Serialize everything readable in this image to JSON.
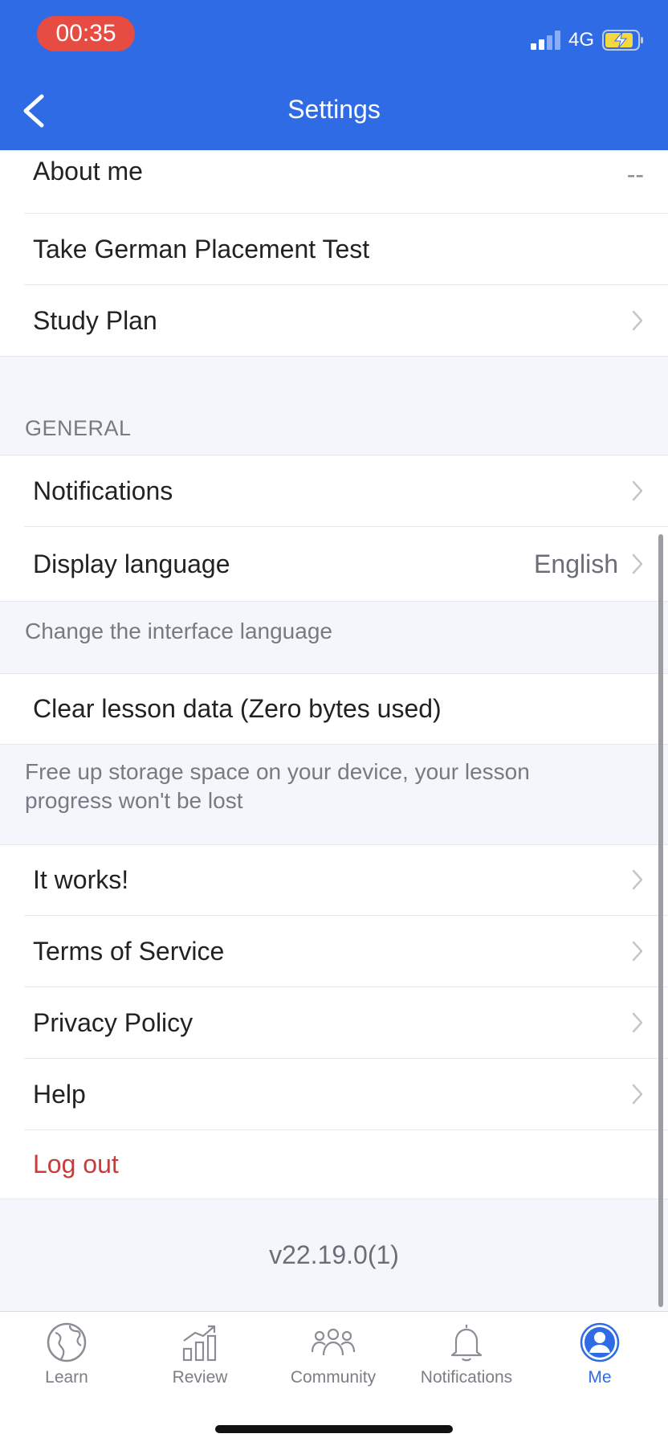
{
  "status_bar": {
    "time": "00:35",
    "network": "4G"
  },
  "header": {
    "title": "Settings"
  },
  "profile": {
    "about_me": {
      "label": "About me",
      "value": "--"
    },
    "placement_test": {
      "label": "Take German Placement Test"
    },
    "study_plan": {
      "label": "Study Plan"
    }
  },
  "general": {
    "section_title": "GENERAL",
    "notifications": {
      "label": "Notifications"
    },
    "display_language": {
      "label": "Display language",
      "value": "English",
      "hint": "Change the interface language"
    },
    "clear_data": {
      "label": "Clear lesson data (Zero bytes used)",
      "hint": "Free up storage space on your device, your lesson progress won't be lost"
    }
  },
  "links": {
    "it_works": "It works!",
    "terms": "Terms of Service",
    "privacy": "Privacy Policy",
    "help": "Help",
    "logout": "Log out"
  },
  "version": "v22.19.0(1)",
  "tabs": [
    {
      "label": "Learn",
      "icon": "globe-icon"
    },
    {
      "label": "Review",
      "icon": "bar-chart-icon"
    },
    {
      "label": "Community",
      "icon": "people-icon"
    },
    {
      "label": "Notifications",
      "icon": "bell-icon"
    },
    {
      "label": "Me",
      "icon": "person-icon",
      "active": true
    }
  ],
  "colors": {
    "primary": "#306be6",
    "danger": "#c93c3c",
    "time_pill": "#e74c43"
  }
}
